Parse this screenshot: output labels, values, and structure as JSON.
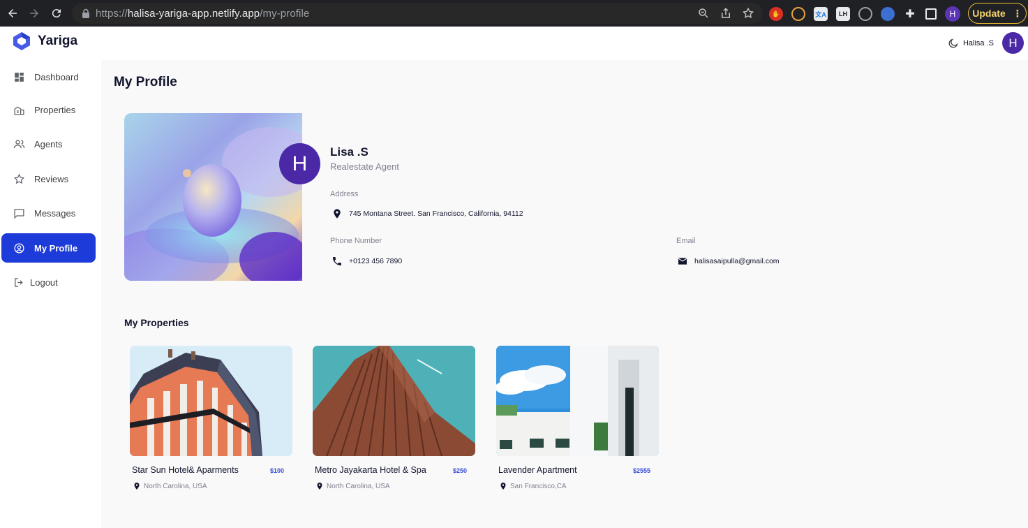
{
  "browser": {
    "url_scheme": "https://",
    "url_host": "halisa-yariga-app.netlify.app",
    "url_path": "/my-profile",
    "profile_initial": "H",
    "update_label": "Update"
  },
  "header": {
    "app_name": "Yariga",
    "user_name": "Halisa .S",
    "avatar_initial": "H",
    "brand_color": "#475be8"
  },
  "sidebar": {
    "items": [
      {
        "label": "Dashboard",
        "icon": "dashboard-icon"
      },
      {
        "label": "Properties",
        "icon": "properties-icon"
      },
      {
        "label": "Agents",
        "icon": "agents-icon"
      },
      {
        "label": "Reviews",
        "icon": "star-icon"
      },
      {
        "label": "Messages",
        "icon": "message-icon"
      },
      {
        "label": "My Profile",
        "icon": "profile-icon",
        "active": true
      },
      {
        "label": "Logout",
        "icon": "logout-icon"
      }
    ],
    "active_color": "#1d3bd8"
  },
  "page": {
    "title": "My Profile"
  },
  "profile": {
    "avatar_initial": "H",
    "name": "Lisa .S",
    "role": "Realestate Agent",
    "address_label": "Address",
    "address": "745 Montana Street. San Francisco, California, 94112",
    "phone_label": "Phone Number",
    "phone": "+0123 456 7890",
    "email_label": "Email",
    "email": "halisasaipulla@gmail.com"
  },
  "properties": {
    "title": "My Properties",
    "items": [
      {
        "title": "Star Sun Hotel& Aparments",
        "price": "$100",
        "location": "North Carolina, USA"
      },
      {
        "title": "Metro Jayakarta Hotel & Spa",
        "price": "$250",
        "location": "North Carolina, USA"
      },
      {
        "title": "Lavender Apartment",
        "price": "$2555",
        "location": "San Francisco,CA"
      }
    ]
  }
}
